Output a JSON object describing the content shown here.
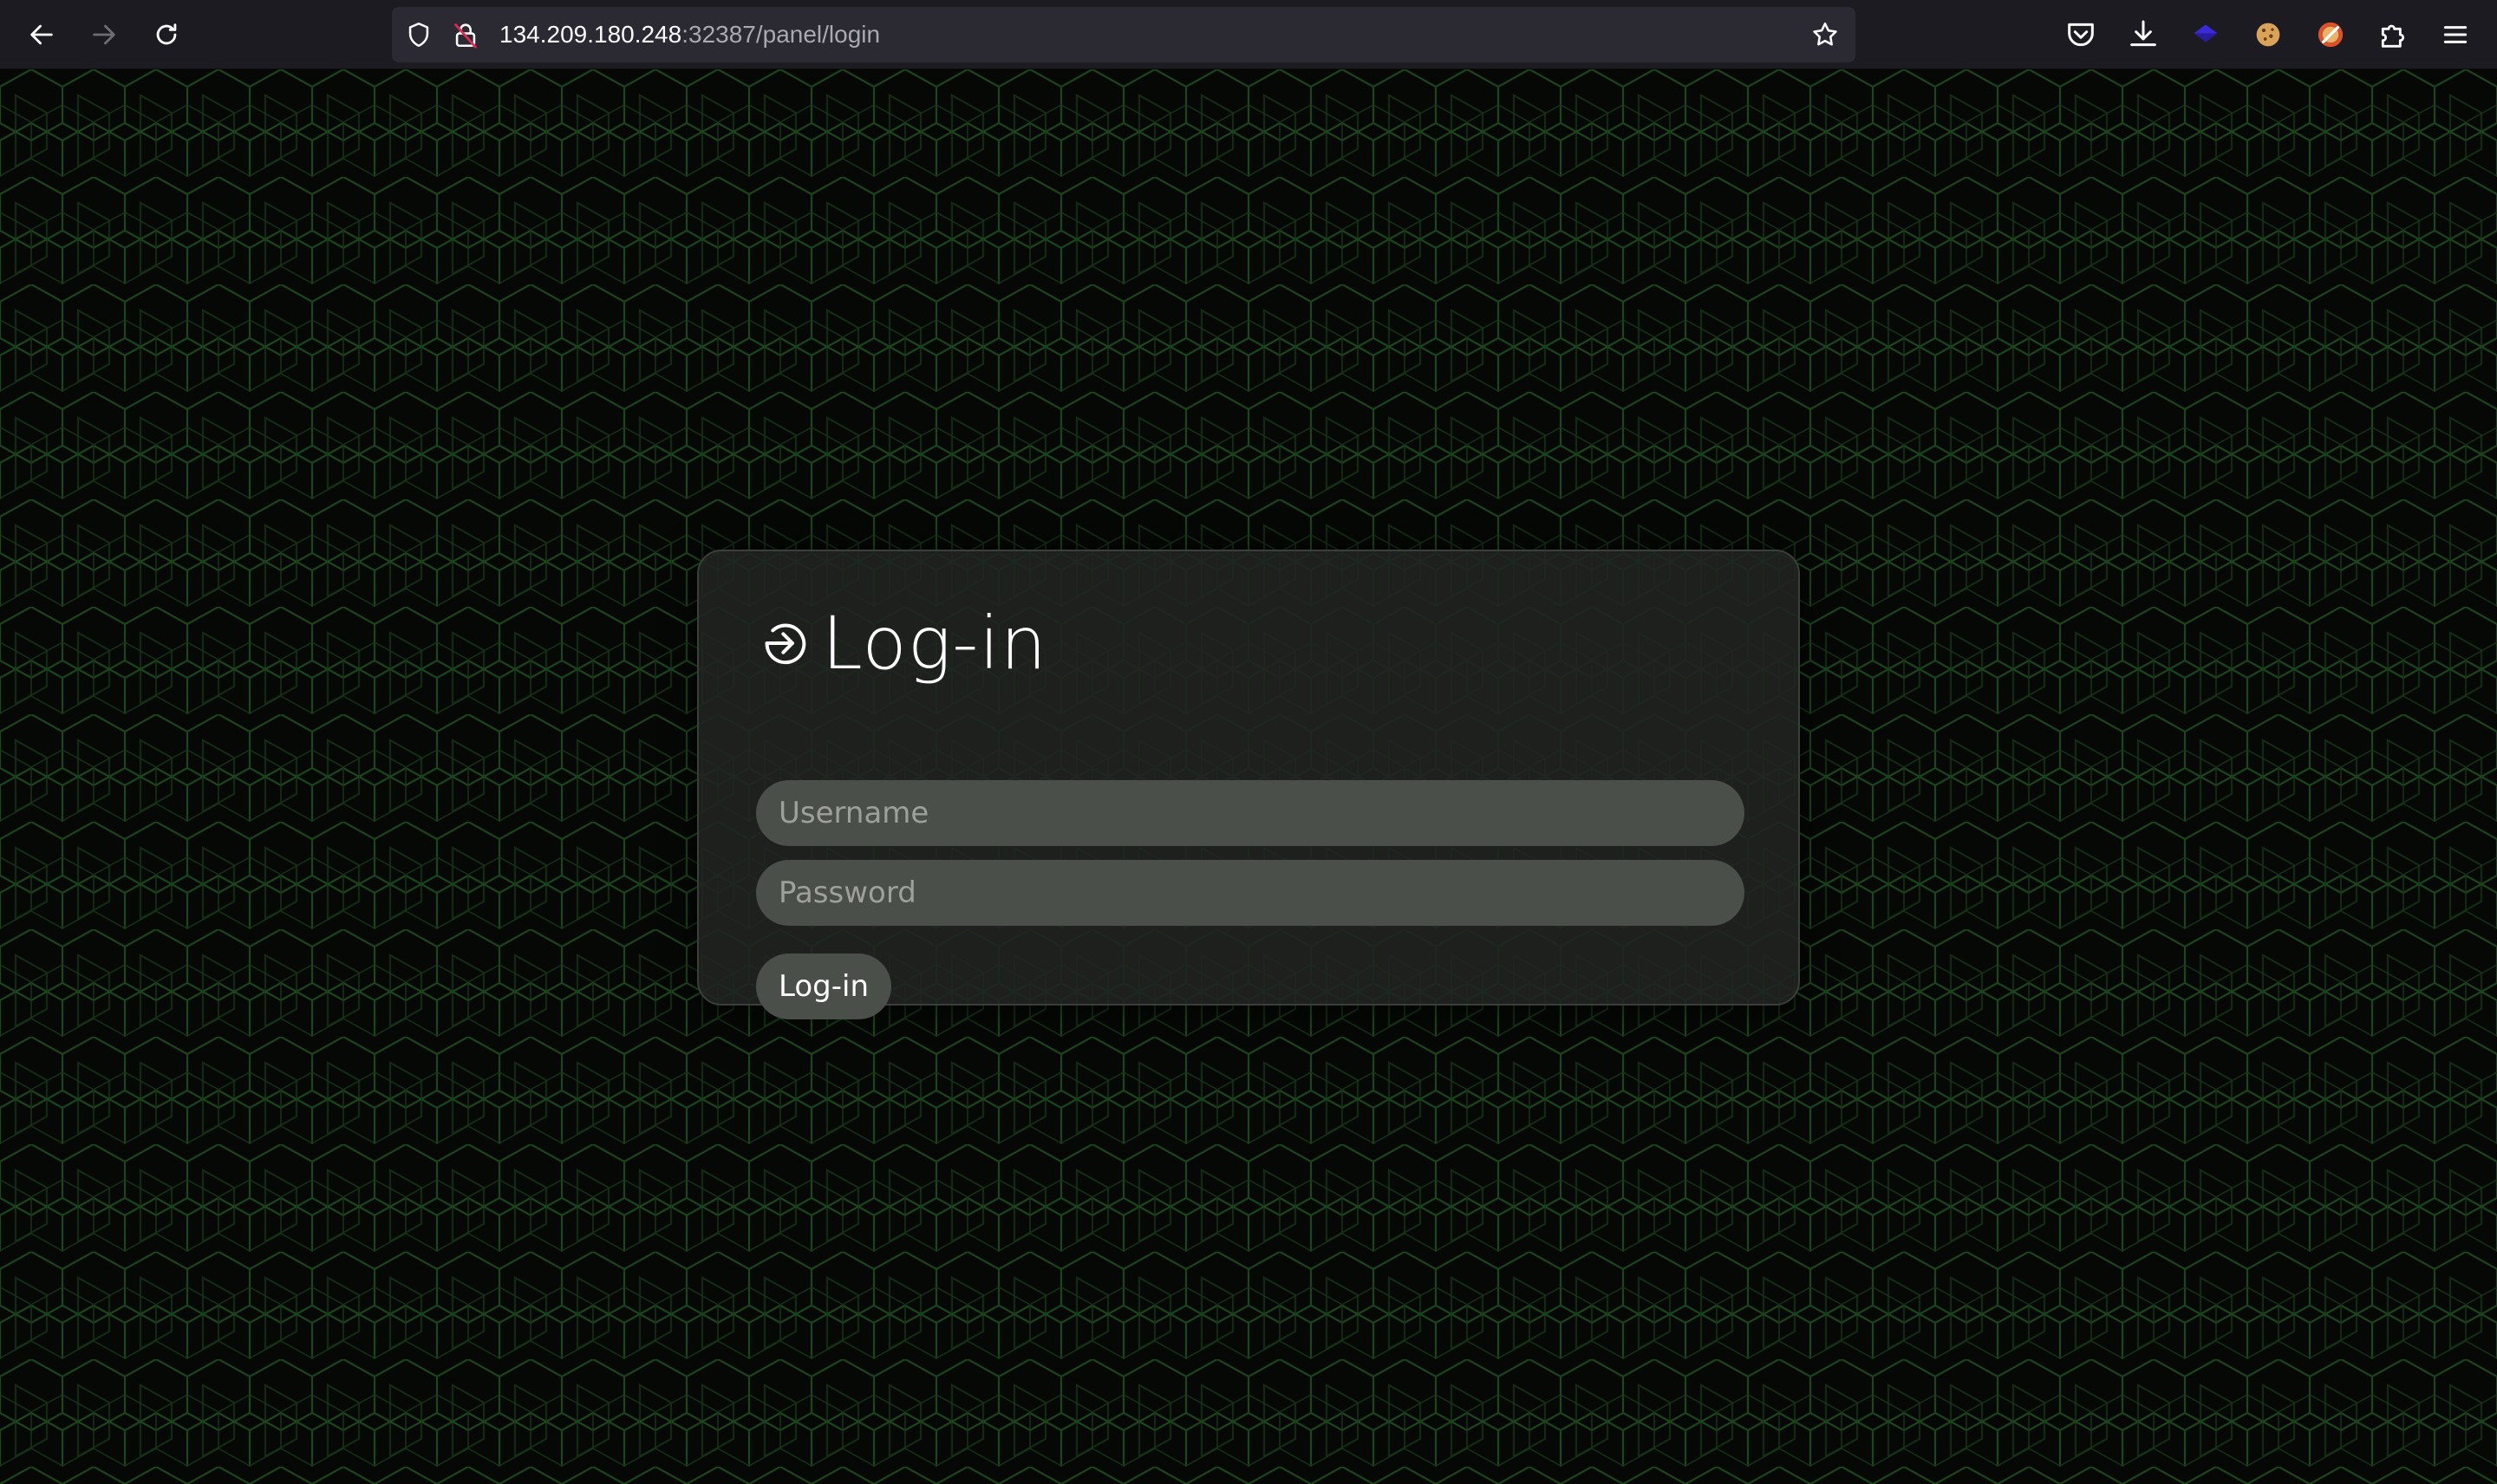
{
  "browser": {
    "url_host": "134.209.180.248",
    "url_path": ":32387/panel/login",
    "back_icon": "back-arrow-icon",
    "forward_icon": "forward-arrow-icon",
    "reload_icon": "reload-icon",
    "toolbar_color": "#1c1b22",
    "urlbar_color": "#2b2a33",
    "extensions": [
      "pocket-icon",
      "downloads-icon",
      "purple-extension-icon",
      "cookie-extension-icon",
      "cookie-editor-extension-icon",
      "extensions-puzzle-icon",
      "menu-hamburger-icon"
    ]
  },
  "login": {
    "title": "Log-in",
    "title_icon": "login-arrow-icon",
    "username_placeholder": "Username",
    "password_placeholder": "Password",
    "submit_label": "Log-in",
    "accent_pattern_color": "#1f4a1f",
    "card_color": "#202320",
    "field_color": "#4a4f49"
  }
}
